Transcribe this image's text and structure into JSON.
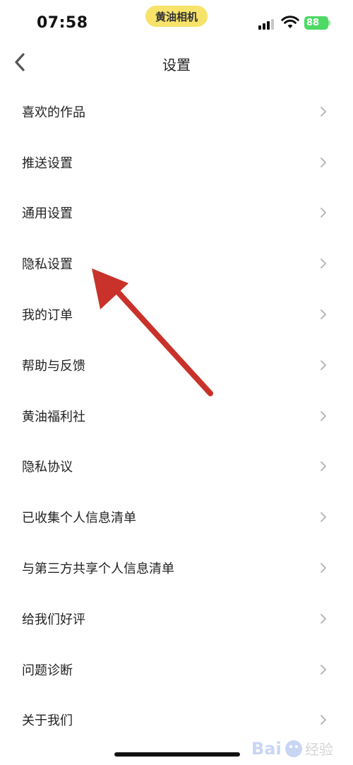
{
  "status_bar": {
    "time": "07:58",
    "app_pill": "黄油相机",
    "battery": "88",
    "signal_icon": "cellular-signal-icon",
    "wifi_icon": "wifi-icon",
    "battery_icon": "battery-charging-icon"
  },
  "nav": {
    "title": "设置",
    "back_icon": "chevron-left-icon"
  },
  "settings": {
    "items": [
      {
        "label": "喜欢的作品"
      },
      {
        "label": "推送设置"
      },
      {
        "label": "通用设置"
      },
      {
        "label": "隐私设置"
      },
      {
        "label": "我的订单"
      },
      {
        "label": "帮助与反馈"
      },
      {
        "label": "黄油福利社"
      },
      {
        "label": "隐私协议"
      },
      {
        "label": "已收集个人信息清单"
      },
      {
        "label": "与第三方共享个人信息清单"
      },
      {
        "label": "给我们好评"
      },
      {
        "label": "问题诊断"
      },
      {
        "label": "关于我们"
      }
    ]
  },
  "colors": {
    "pill": "#f7e36a",
    "battery": "#4cd964",
    "arrow": "#c8322a",
    "chevron": "#b0b0b0"
  },
  "watermark": {
    "text": "Bai 经验"
  }
}
